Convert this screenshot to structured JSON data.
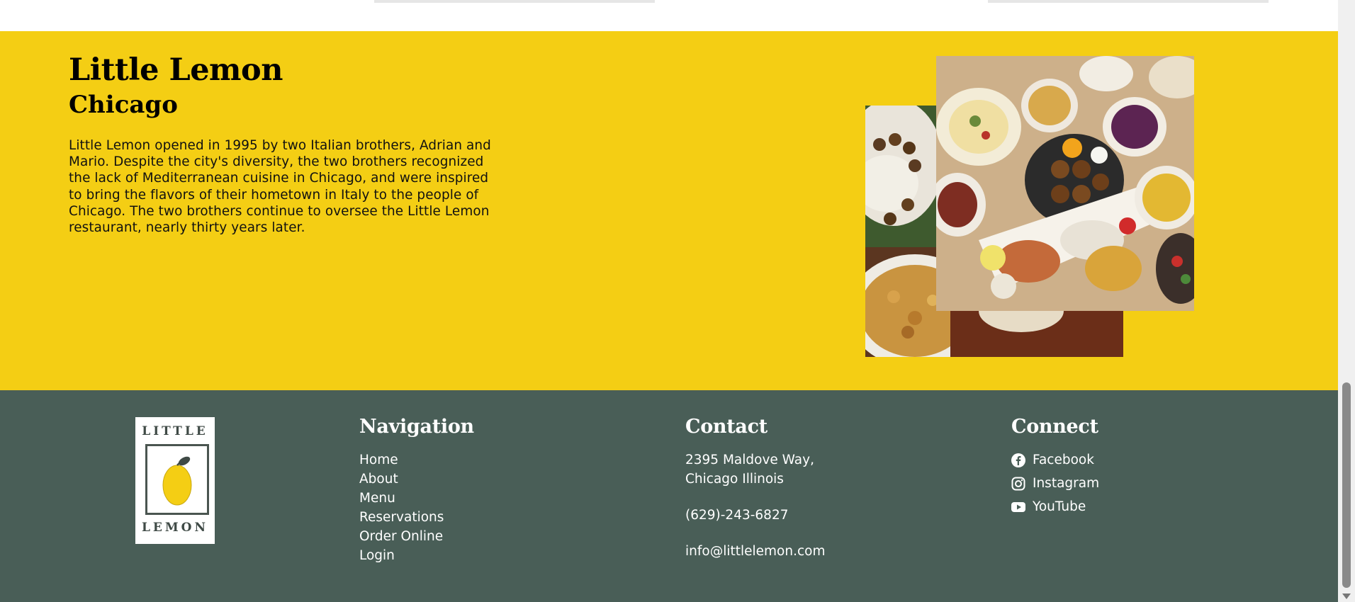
{
  "about": {
    "title": "Little Lemon",
    "subtitle": "Chicago",
    "description": "Little Lemon opened in 1995 by two Italian brothers, Adrian and Mario. Despite the city's diversity, the two brothers recognized the lack of Mediterranean cuisine in Chicago, and were inspired to bring the flavors of their hometown in Italy to the people of Chicago. The two brothers continue to oversee the Little Lemon restaurant, nearly thirty years later."
  },
  "footer": {
    "logo": {
      "top": "LITTLE",
      "bottom": "LEMON"
    },
    "navigation": {
      "heading": "Navigation",
      "links": [
        "Home",
        "About",
        "Menu",
        "Reservations",
        "Order Online",
        "Login"
      ]
    },
    "contact": {
      "heading": "Contact",
      "address_line1": "2395 Maldove Way,",
      "address_line2": "Chicago Illinois",
      "phone": "(629)-243-6827",
      "email": "info@littlelemon.com"
    },
    "connect": {
      "heading": "Connect",
      "links": [
        {
          "label": "Facebook",
          "icon": "facebook-icon"
        },
        {
          "label": "Instagram",
          "icon": "instagram-icon"
        },
        {
          "label": "YouTube",
          "icon": "youtube-icon"
        }
      ]
    }
  },
  "colors": {
    "primary_yellow": "#F4CE14",
    "primary_green": "#495E57",
    "white": "#FFFFFF"
  }
}
